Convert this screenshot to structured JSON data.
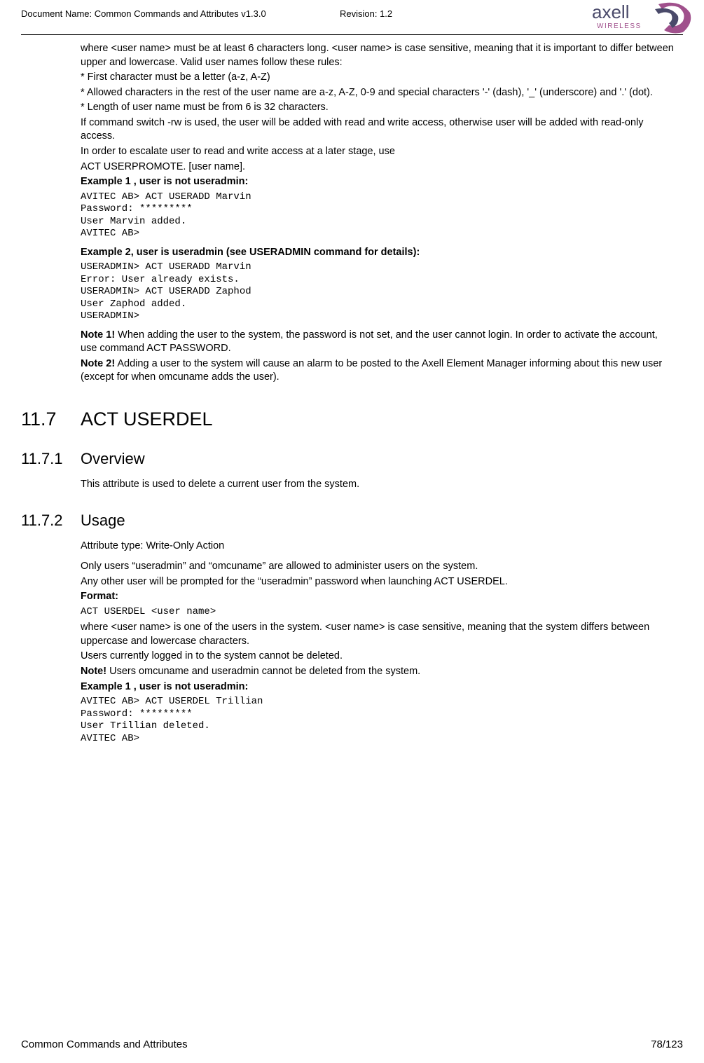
{
  "header": {
    "doc_name": "Document Name: Common Commands and Attributes v1.3.0",
    "revision": "Revision: 1.2",
    "logo_text_main": "axell",
    "logo_text_sub": "WIRELESS"
  },
  "body": {
    "p1": "where <user name> must be at least 6 characters long. <user name> is case sensitive, meaning that it is important to differ between upper and lowercase. Valid user names follow these rules:",
    "r1": "* First character must be a letter (a-z, A-Z)",
    "r2": "* Allowed characters in the rest of the user name are a-z, A-Z, 0-9 and special characters '-' (dash), '_' (underscore) and '.' (dot).",
    "r3": "* Length of user name must be from 6 is 32 characters.",
    "p2": "If command switch -rw is used, the user will be added with read and write access, otherwise user will be added with read-only access.",
    "p3": "In order to escalate user to read and write access at a later stage, use",
    "p3b": "ACT USERPROMOTE. [user name].",
    "ex1_title": "Example 1 , user is not useradmin:",
    "ex1_code": "AVITEC AB> ACT USERADD Marvin\nPassword: *********\nUser Marvin added.\nAVITEC AB>",
    "ex2_title": "Example 2, user is useradmin (see USERADMIN command for details):",
    "ex2_code": "USERADMIN> ACT USERADD Marvin\nError: User already exists.\nUSERADMIN> ACT USERADD Zaphod\nUser Zaphod added.\nUSERADMIN>",
    "note1_b": "Note 1!",
    "note1_t": " When adding the user to the system, the password is not set, and the user cannot login. In order to activate the account, use command ACT PASSWORD.",
    "note2_b": "Note 2!",
    "note2_t": " Adding a user to the system will cause an alarm to be posted to the Axell Element Manager informing about this new user (except for when omcuname adds the user).",
    "s117_num": "11.7",
    "s117_title": "ACT USERDEL",
    "s1171_num": "11.7.1",
    "s1171_title": "Overview",
    "s1171_p": "This attribute is used to delete a current user from the system.",
    "s1172_num": "11.7.2",
    "s1172_title": "Usage",
    "s1172_p1": "Attribute type: Write-Only Action",
    "s1172_p2": "Only users “useradmin” and “omcuname” are allowed to administer users on the system.",
    "s1172_p3": "Any other user will be prompted for the “useradmin” password when launching ACT USERDEL.",
    "format_b": "Format:",
    "format_code": "ACT USERDEL <user name>",
    "s1172_p4": "where <user name> is one of the users in the system. <user name> is case sensitive, meaning that the system differs between uppercase and lowercase characters.",
    "s1172_p5": "Users currently logged in to the system cannot be deleted.",
    "noteU_b": "Note!",
    "noteU_t": " Users omcuname and useradmin cannot be deleted from the system.",
    "exU_title": "Example 1 , user is not useradmin:",
    "exU_code": "AVITEC AB> ACT USERDEL Trillian\nPassword: *********\nUser Trillian deleted.\nAVITEC AB>"
  },
  "footer": {
    "left": "Common Commands and Attributes",
    "right": "78/123"
  }
}
